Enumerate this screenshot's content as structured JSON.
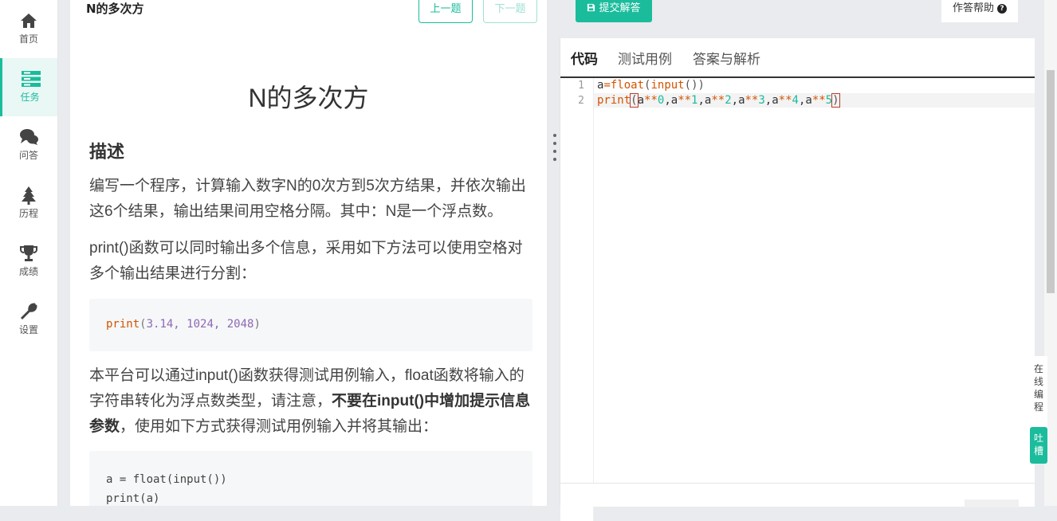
{
  "nav": {
    "items": [
      {
        "label": "首页",
        "icon": "home-icon"
      },
      {
        "label": "任务",
        "icon": "tasks-icon",
        "active": true
      },
      {
        "label": "问答",
        "icon": "chat-icon"
      },
      {
        "label": "历程",
        "icon": "tree-icon"
      },
      {
        "label": "成绩",
        "icon": "trophy-icon"
      },
      {
        "label": "设置",
        "icon": "wrench-icon"
      }
    ]
  },
  "problem": {
    "header_title": "N的多次方",
    "prev_label": "上一题",
    "next_label": "下一题",
    "title": "N的多次方",
    "section_heading": "描述",
    "para1": "编写一个程序，计算输入数字N的0次方到5次方结果，并依次输出这6个结果，输出结果间用空格分隔。其中：N是一个浮点数。",
    "para2": "print()函数可以同时输出多个信息，采用如下方法可以使用空格对多个输出结果进行分割：",
    "example1": {
      "fn": "print",
      "args": "3.14, 1024, 2048"
    },
    "para3_a": "本平台可以通过input()函数获得测试用例输入，float函数将输入的字符串转化为浮点数类型，请注意，",
    "para3_bold": "不要在input()中增加提示信息参数",
    "para3_b": "，使用如下方式获得测试用例输入并将其输出：",
    "example2": {
      "line1": "a = float(input())",
      "line2": "print(a)"
    }
  },
  "editor": {
    "submit_label": "提交解答",
    "help_label": "作答帮助",
    "tabs": [
      "代码",
      "测试用例",
      "答案与解析"
    ],
    "active_tab": "代码",
    "lines": [
      {
        "num": "1",
        "text": "a=float(input())"
      },
      {
        "num": "2",
        "text": "print(a**0,a**1,a**2,a**3,a**4,a**5)"
      }
    ]
  },
  "side": {
    "online_tab": "在线编程",
    "feedback_tab": "吐槽"
  },
  "colors": {
    "accent": "#1abc9c"
  }
}
